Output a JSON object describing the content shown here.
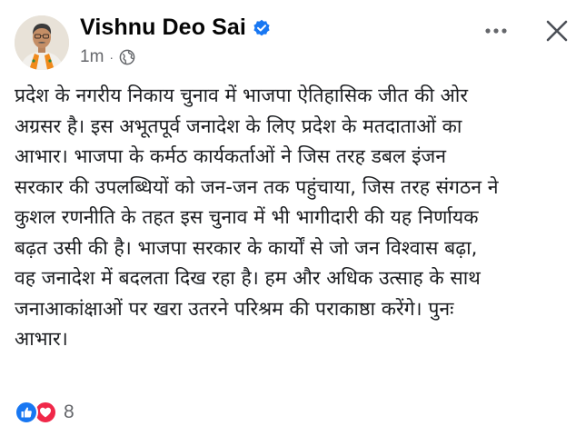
{
  "post": {
    "author": "Vishnu Deo Sai",
    "verified": true,
    "timestamp": "1m",
    "separator": "·",
    "privacy_icon": "globe-icon",
    "body_lines": [
      "प्रदेश के नगरीय निकाय चुनाव में भाजपा ऐतिहासिक जीत की ओर",
      "अग्रसर है। इस अभूतपूर्व जनादेश के लिए प्रदेश के मतदाताओं का",
      "आभार। भाजपा के कर्मठ कार्यकर्ताओं ने जिस तरह डबल इंजन",
      "सरकार की उपलब्धियों को जन-जन तक पहुंचाया, जिस तरह संगठन ने",
      "कुशल रणनीति के तहत इस चुनाव में भी भागीदारी की यह निर्णायक",
      "बढ़त उसी की है। भाजपा सरकार के कार्यों से जो जन विश्वास बढ़ा,",
      "वह जनादेश में बदलता दिख रहा है। हम और अधिक उत्साह के साथ",
      "जनाआकांक्षाओं पर खरा उतरने परिश्रम की पराकाष्ठा करेंगे। पुनः",
      "आभार।"
    ]
  },
  "reactions": {
    "icons": [
      "like-icon",
      "love-icon"
    ],
    "count": "8"
  },
  "header_actions": {
    "more_icon": "more-icon",
    "close_icon": "close-icon"
  },
  "colors": {
    "facebook_blue": "#1877f2",
    "love_red": "#f02849",
    "secondary_text": "#65676b",
    "primary_text": "#050505"
  }
}
